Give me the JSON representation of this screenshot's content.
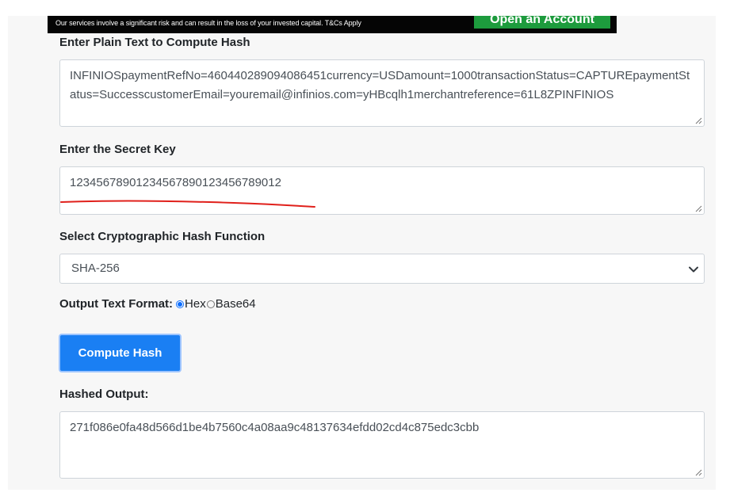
{
  "ad": {
    "disclaimer": "Our services involve a significant risk and can result in the loss of your invested capital. T&Cs Apply",
    "cta_label": "Open an Account"
  },
  "form": {
    "plain_text_label": "Enter Plain Text to Compute Hash",
    "plain_text_value": "INFINIOSpaymentRefNo=460440289094086451currency=USDamount=1000transactionStatus=CAPTUREpaymentStatus=SuccesscustomerEmail=youremail@infinios.com=yHBcqlh1merchantreference=61L8ZPINFINIOS",
    "secret_key_label": "Enter the Secret Key",
    "secret_key_value": "12345678901234567890123456789012",
    "hash_function_label": "Select Cryptographic Hash Function",
    "hash_function_value": "SHA-256",
    "output_format_label": "Output Text Format:",
    "output_formats": [
      "Hex",
      "Base64"
    ],
    "output_format_selected": "Hex",
    "compute_button_label": "Compute Hash",
    "hashed_output_label": "Hashed Output:",
    "hashed_output_value": "271f086e0fa48d566d1be4b7560c4a08aa9c48137634efdd02cd4c875edc3cbb"
  },
  "colors": {
    "primary": "#1a7ff3",
    "annotation_red": "#e0201b",
    "ad_green": "#1d9b3d"
  }
}
